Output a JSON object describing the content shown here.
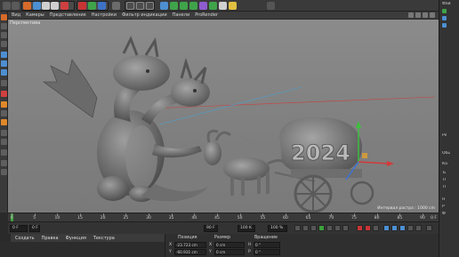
{
  "menu": {
    "items": [
      "Вид",
      "Камеры",
      "Представление",
      "Настройки",
      "Фильтр индикации",
      "Панели",
      "ProRender"
    ]
  },
  "viewport": {
    "label": "Перспектива",
    "info": "Интервал растра : 1000 cm",
    "sculpture_text": "2024"
  },
  "timeline": {
    "ticks": [
      "0",
      "5",
      "10",
      "15",
      "20",
      "25",
      "30",
      "35",
      "40",
      "45",
      "50",
      "55",
      "60",
      "65",
      "70",
      "75",
      "80",
      "85",
      "90"
    ],
    "end_label": "0 F"
  },
  "transport": {
    "start": "0 F",
    "current": "0 F",
    "end": "90 F",
    "fps": "100 K",
    "zoom": "100 %"
  },
  "material_menu": [
    "Создать",
    "Правка",
    "Функция",
    "Текстура"
  ],
  "coordinates": {
    "headers": [
      "Позиция",
      "Размер",
      "Вращение"
    ],
    "rows": [
      {
        "axis": "X",
        "pos": "-23.723 cm",
        "size": "0 cm",
        "rot_axis": "H",
        "rot": "0 °"
      },
      {
        "axis": "Y",
        "pos": "-60.931 cm",
        "size": "0 cm",
        "rot_axis": "P",
        "rot": "0 °"
      }
    ]
  },
  "right_panel": {
    "labels": [
      "Фай",
      "Ре",
      "Обь",
      "Ко",
      "Б",
      "П",
      "П",
      "Н",
      "Р",
      "Ф"
    ]
  },
  "colors": {
    "viewport_bg": "#858585",
    "accent_green": "#3da03d",
    "accent_orange": "#e0882a",
    "accent_blue": "#4d8fd1"
  }
}
